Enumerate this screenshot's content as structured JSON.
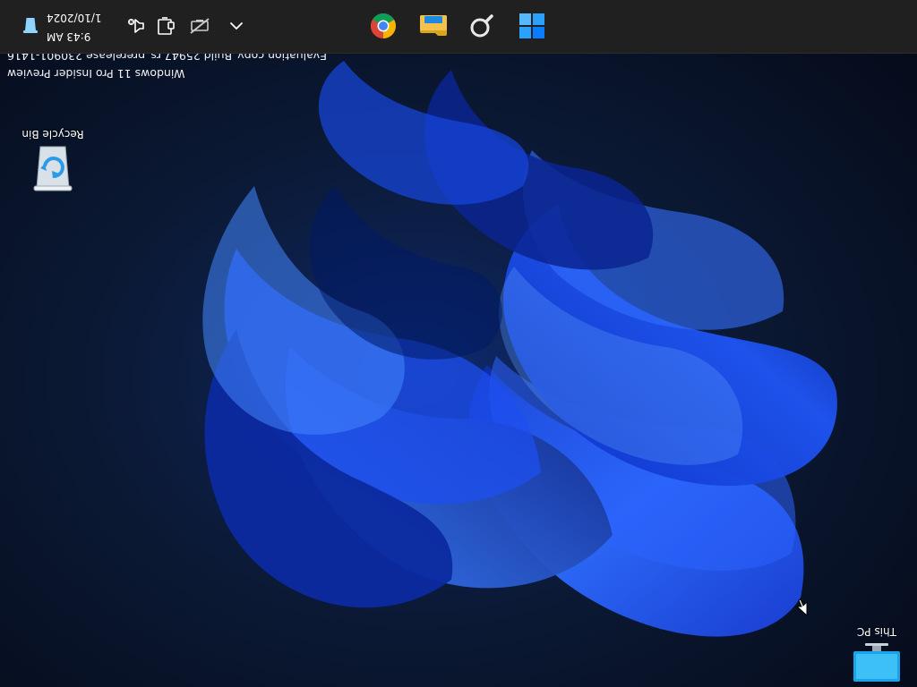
{
  "desktop": {
    "icons": [
      {
        "label": "This PC",
        "icon": "computer-monitor-icon"
      },
      {
        "label": "Recycle Bin",
        "icon": "recycle-bin-icon"
      }
    ],
    "watermark": {
      "line1": "Windows 11 Pro Insider Preview",
      "line2": "Evaluation copy. Build 25947.rs_prerelease.230901-1416"
    }
  },
  "taskbar": {
    "apps": [
      {
        "name": "Start",
        "icon": "windows-logo-icon"
      },
      {
        "name": "Search",
        "icon": "search-icon"
      },
      {
        "name": "File Explorer",
        "icon": "folder-icon"
      },
      {
        "name": "Google Chrome",
        "icon": "chrome-icon"
      }
    ],
    "tray": {
      "icons": [
        "chevron-up-icon",
        "network-offline-icon",
        "display-icon",
        "sound-muted-icon",
        "recycle-bin-icon"
      ],
      "time": "9:43 AM",
      "date": "1/10/2024"
    }
  },
  "colors": {
    "taskbar": "#202020",
    "accent_blue": "#0a5cff",
    "start_blue": "#0078d4",
    "folder_yellow": "#f3c24a"
  }
}
